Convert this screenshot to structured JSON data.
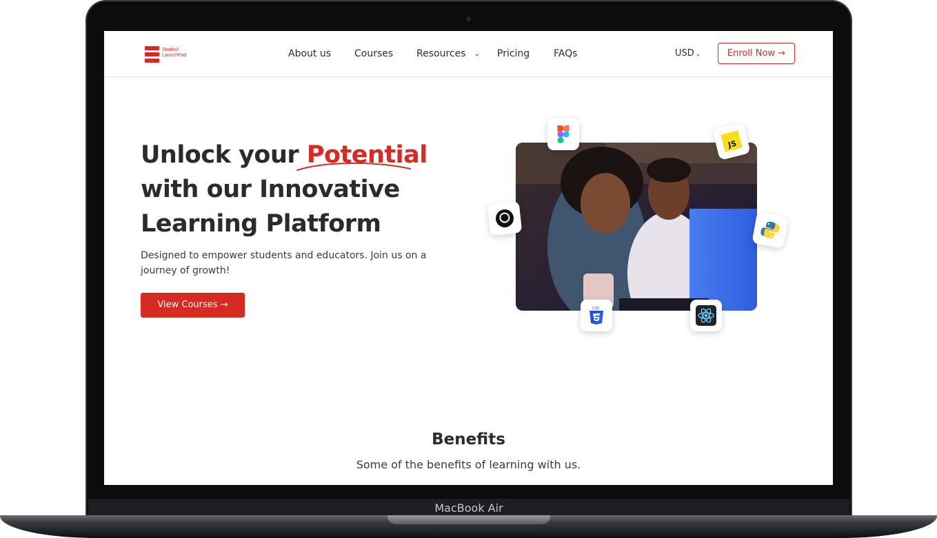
{
  "device": {
    "label": "MacBook Air"
  },
  "brand": {
    "name_line1": "Studio3",
    "name_line2": "LaunchPad",
    "accent_color": "#d72a22"
  },
  "nav": {
    "links": [
      "About us",
      "Courses",
      "Resources",
      "Pricing",
      "FAQs"
    ],
    "currency": "USD",
    "enroll_label": "Enroll Now →"
  },
  "hero": {
    "title_part1": "Unlock your",
    "title_highlight": "Potential",
    "title_line2": "with our Innovative",
    "title_line3": "Learning Platform",
    "description": "Designed to empower students and educators. Join us on a journey of growth!",
    "cta_label": "View Courses →"
  },
  "tech_icons": [
    "figma-icon",
    "javascript-icon",
    "github-icon",
    "python-icon",
    "css3-icon",
    "react-icon"
  ],
  "benefits": {
    "title": "Benefits",
    "subtitle": "Some of the benefits of learning with us."
  }
}
